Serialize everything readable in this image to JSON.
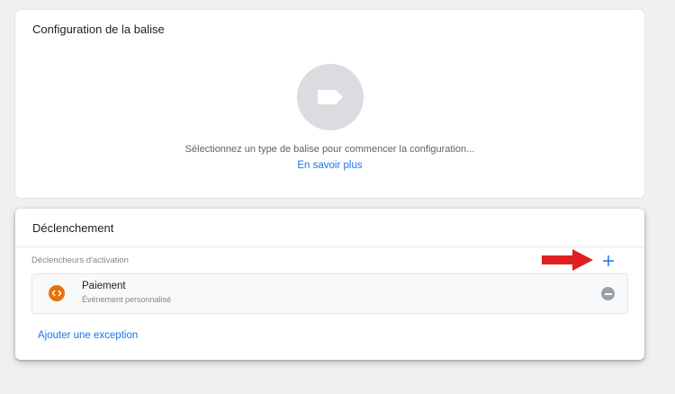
{
  "config_card": {
    "title": "Configuration de la balise",
    "message": "Sélectionnez un type de balise pour commencer la configuration...",
    "learn_more": "En savoir plus",
    "icon": "tag-icon"
  },
  "trigger_card": {
    "title": "Déclenchement",
    "section_label": "Déclencheurs d'activation",
    "add_icon": "plus-icon",
    "triggers": [
      {
        "name": "Paiement",
        "type": "Événement personnalisé",
        "icon": "code-icon",
        "icon_color": "#e8710a"
      }
    ],
    "add_exception": "Ajouter une exception"
  },
  "annotation": {
    "arrow_color": "#e02020"
  },
  "colors": {
    "link": "#1a73e8",
    "background": "#eef0f2"
  }
}
